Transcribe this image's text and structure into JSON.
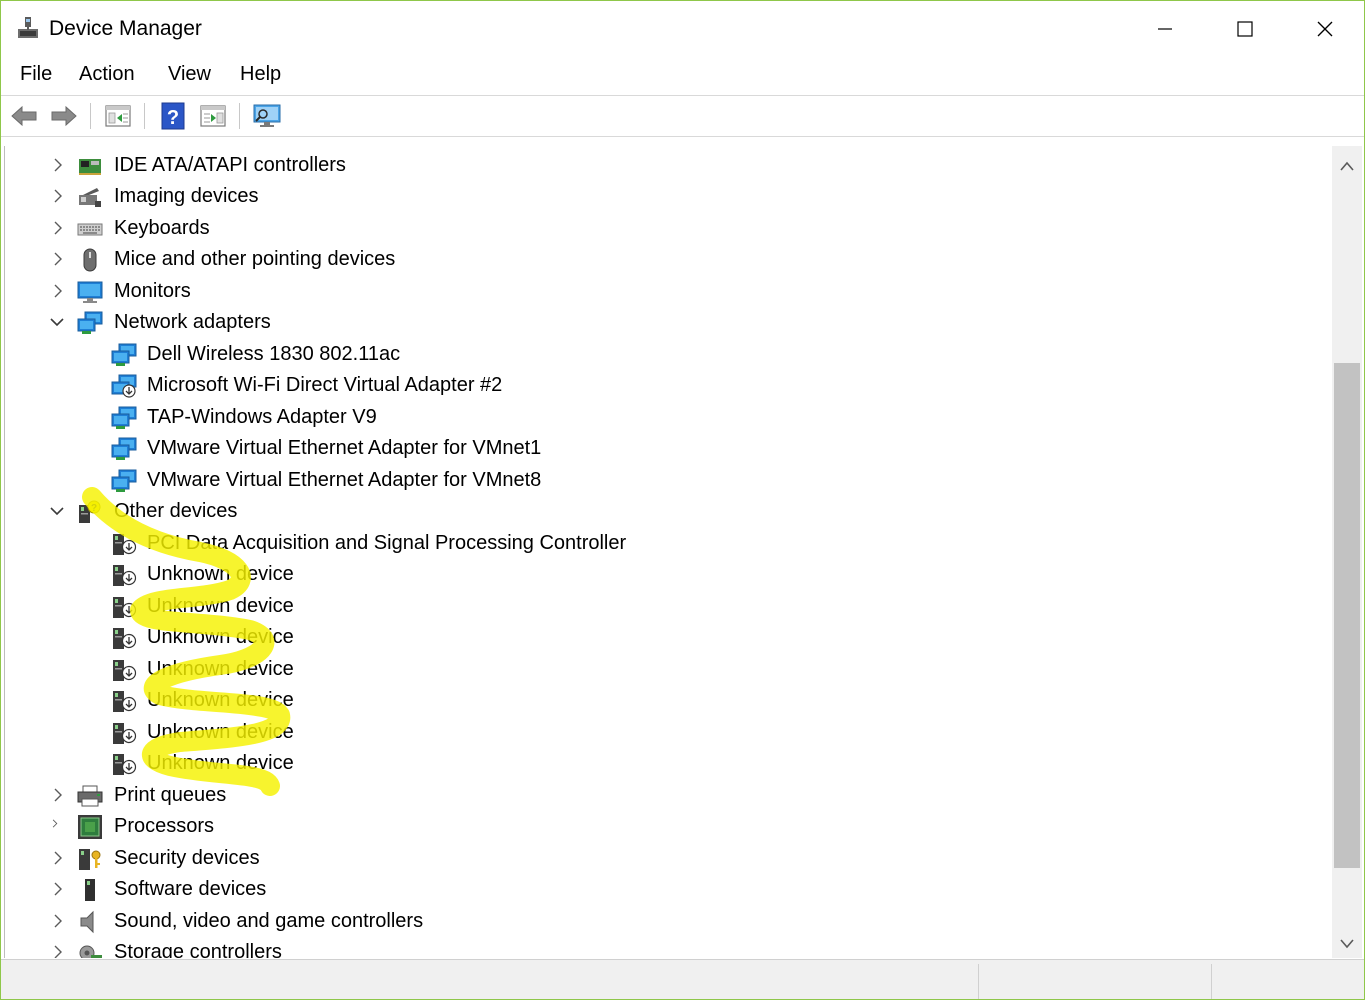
{
  "window": {
    "title": "Device Manager",
    "border_color": "#8fc74a"
  },
  "menu": {
    "file": "File",
    "action": "Action",
    "view": "View",
    "help": "Help"
  },
  "toolbar": {
    "buttons": [
      "back-arrow-icon",
      "forward-arrow-icon",
      "properties-pane-icon",
      "help-icon",
      "details-pane-icon",
      "scan-hardware-icon"
    ]
  },
  "tree": {
    "rows": [
      {
        "label": "IDE ATA/ATAPI controllers",
        "expanded": false
      },
      {
        "label": "Imaging devices",
        "expanded": false
      },
      {
        "label": "Keyboards",
        "expanded": false
      },
      {
        "label": "Mice and other pointing devices",
        "expanded": false
      },
      {
        "label": "Monitors",
        "expanded": false
      },
      {
        "label": "Network adapters",
        "expanded": true
      },
      {
        "label": "Dell Wireless 1830 802.11ac"
      },
      {
        "label": "Microsoft Wi-Fi Direct Virtual Adapter #2"
      },
      {
        "label": "TAP-Windows Adapter V9"
      },
      {
        "label": "VMware Virtual Ethernet Adapter for VMnet1"
      },
      {
        "label": "VMware Virtual Ethernet Adapter for VMnet8"
      },
      {
        "label": "Other devices",
        "expanded": true
      },
      {
        "label": "PCI Data Acquisition and Signal Processing Controller"
      },
      {
        "label": "Unknown device"
      },
      {
        "label": "Unknown device"
      },
      {
        "label": "Unknown device"
      },
      {
        "label": "Unknown device"
      },
      {
        "label": "Unknown device"
      },
      {
        "label": "Unknown device"
      },
      {
        "label": "Unknown device"
      },
      {
        "label": "Print queues",
        "expanded": false
      },
      {
        "label": "Processors",
        "expanded": false
      },
      {
        "label": "Security devices",
        "expanded": false
      },
      {
        "label": "Software devices",
        "expanded": false
      },
      {
        "label": "Sound, video and game controllers",
        "expanded": false
      },
      {
        "label": "Storage controllers",
        "expanded": false
      }
    ]
  },
  "colors": {
    "highlighter": "#f5f200",
    "accent_blue": "#1e7fd6"
  }
}
